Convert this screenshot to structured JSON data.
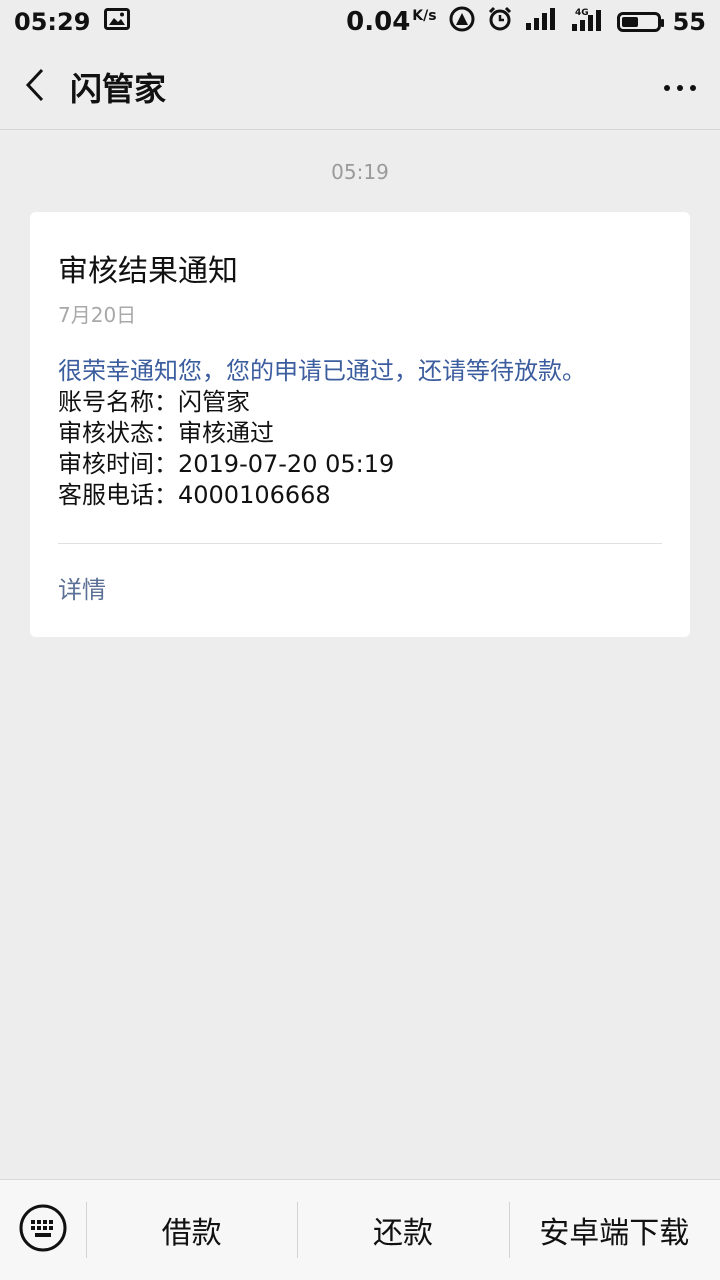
{
  "status_bar": {
    "time": "05:29",
    "speed": "0.04",
    "speed_unit": "K/s",
    "network": "4G",
    "battery_level": "55"
  },
  "nav": {
    "title": "闪管家"
  },
  "chat": {
    "timestamp": "05:19",
    "card": {
      "title": "审核结果通知",
      "date": "7月20日",
      "intro": "很荣幸通知您，您的申请已通过，还请等待放款。",
      "lines": [
        "账号名称：闪管家",
        "审核状态：审核通过",
        "审核时间：2019-07-20 05:19",
        "客服电话：4000106668"
      ],
      "detail_label": "详情"
    }
  },
  "bottom_menu": {
    "items": [
      "借款",
      "还款",
      "安卓端下载"
    ]
  },
  "colors": {
    "background": "#ededed",
    "link_blue": "#3c5e9e",
    "card": "#ffffff"
  }
}
